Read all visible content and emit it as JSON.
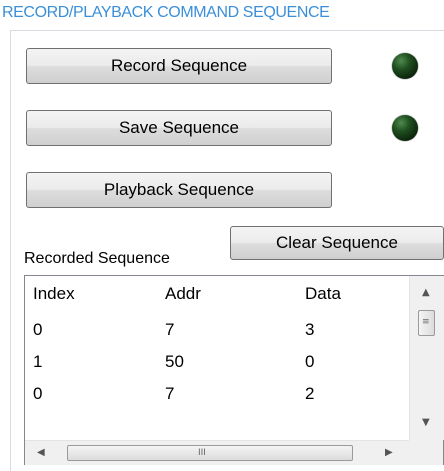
{
  "group": {
    "title": "RECORD/PLAYBACK COMMAND SEQUENCE"
  },
  "buttons": {
    "record": "Record Sequence",
    "save": "Save Sequence",
    "playback": "Playback Sequence",
    "clear": "Clear Sequence"
  },
  "indicators": {
    "record_led_color": "#123a12",
    "save_led_color": "#123a12"
  },
  "sequence": {
    "label": "Recorded Sequence",
    "columns": [
      "Index",
      "Addr",
      "Data"
    ],
    "rows": [
      [
        "0",
        "7",
        "3"
      ],
      [
        "1",
        "50",
        "0"
      ],
      [
        "0",
        "7",
        "2"
      ]
    ]
  },
  "scrollbar_glyphs": {
    "up": "▲",
    "down": "▼",
    "left": "◀",
    "right": "▶",
    "grip_v": "≡",
    "grip_h": "III"
  }
}
